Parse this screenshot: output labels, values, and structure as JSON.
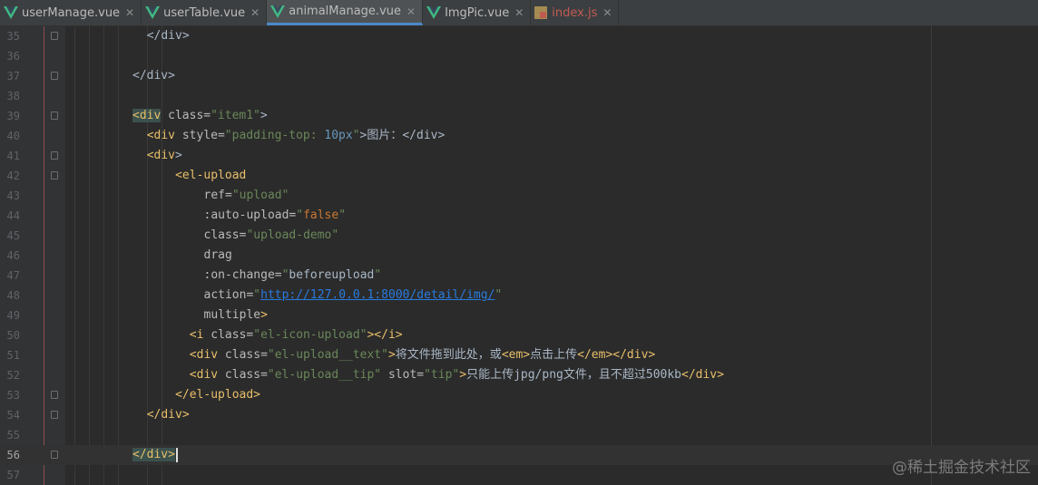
{
  "tabs": [
    {
      "label": "userManage.vue",
      "icon": "vue-icon",
      "active": false
    },
    {
      "label": "userTable.vue",
      "icon": "vue-icon",
      "active": false
    },
    {
      "label": "animalManage.vue",
      "icon": "vue-icon",
      "active": true
    },
    {
      "label": "ImgPic.vue",
      "icon": "vue-icon",
      "active": false
    },
    {
      "label": "index.js",
      "icon": "js-file-icon",
      "active": false
    }
  ],
  "close_glyph": "✕",
  "current_line": 56,
  "lines": [
    {
      "num": "35",
      "fold": true,
      "indent": 2,
      "tokens": [
        [
          "d",
          "</div>"
        ]
      ]
    },
    {
      "num": "36",
      "fold": false,
      "indent": 0,
      "tokens": []
    },
    {
      "num": "37",
      "fold": true,
      "indent": 0,
      "tokens": [
        [
          "d",
          "</div>"
        ]
      ]
    },
    {
      "num": "38",
      "fold": false,
      "indent": 0,
      "tokens": []
    },
    {
      "num": "39",
      "fold": true,
      "indent": 0,
      "tokens": [
        [
          "t",
          "<div"
        ],
        [
          "a",
          " class="
        ],
        [
          "s",
          "\"item1\""
        ],
        [
          "d",
          ">"
        ]
      ]
    },
    {
      "num": "40",
      "fold": false,
      "indent": 2,
      "tokens": [
        [
          "t",
          "<div"
        ],
        [
          "a",
          " style="
        ],
        [
          "s",
          "\"padding-top: "
        ],
        [
          "n",
          "10px"
        ],
        [
          "s",
          "\""
        ],
        [
          "d",
          ">图片：</div>"
        ]
      ]
    },
    {
      "num": "41",
      "fold": true,
      "indent": 2,
      "tokens": [
        [
          "t",
          "<div"
        ],
        [
          "d",
          ">"
        ]
      ]
    },
    {
      "num": "42",
      "fold": true,
      "indent": 6,
      "tokens": [
        [
          "t",
          "<el-upload"
        ]
      ]
    },
    {
      "num": "43",
      "fold": false,
      "indent": 10,
      "tokens": [
        [
          "a",
          "ref="
        ],
        [
          "s",
          "\"upload\""
        ]
      ]
    },
    {
      "num": "44",
      "fold": false,
      "indent": 10,
      "tokens": [
        [
          "a",
          ":auto-upload="
        ],
        [
          "s",
          "\""
        ],
        [
          "k",
          "false"
        ],
        [
          "s",
          "\""
        ]
      ]
    },
    {
      "num": "45",
      "fold": false,
      "indent": 10,
      "tokens": [
        [
          "a",
          "class="
        ],
        [
          "s",
          "\"upload-demo\""
        ]
      ]
    },
    {
      "num": "46",
      "fold": false,
      "indent": 10,
      "tokens": [
        [
          "a",
          "drag"
        ]
      ]
    },
    {
      "num": "47",
      "fold": false,
      "indent": 10,
      "tokens": [
        [
          "a",
          ":on-change="
        ],
        [
          "s",
          "\""
        ],
        [
          "d",
          "beforeupload"
        ],
        [
          "s",
          "\""
        ]
      ]
    },
    {
      "num": "48",
      "fold": false,
      "indent": 10,
      "tokens": [
        [
          "a",
          "action="
        ],
        [
          "s",
          "\""
        ],
        [
          "u",
          "http://127.0.0.1:8000/detail/img/"
        ],
        [
          "s",
          "\""
        ]
      ]
    },
    {
      "num": "49",
      "fold": false,
      "indent": 10,
      "tokens": [
        [
          "a",
          "multiple"
        ],
        [
          "t",
          ">"
        ]
      ]
    },
    {
      "num": "50",
      "fold": false,
      "indent": 8,
      "tokens": [
        [
          "t",
          "<i"
        ],
        [
          "a",
          " class="
        ],
        [
          "s",
          "\"el-icon-upload\""
        ],
        [
          "t",
          "></i>"
        ]
      ]
    },
    {
      "num": "51",
      "fold": false,
      "indent": 8,
      "tokens": [
        [
          "t",
          "<div"
        ],
        [
          "a",
          " class="
        ],
        [
          "s",
          "\"el-upload__text\""
        ],
        [
          "t",
          ">"
        ],
        [
          "d",
          "将文件拖到此处，或"
        ],
        [
          "t",
          "<em>"
        ],
        [
          "d",
          "点击上传"
        ],
        [
          "t",
          "</em></div>"
        ]
      ]
    },
    {
      "num": "52",
      "fold": false,
      "indent": 8,
      "tokens": [
        [
          "t",
          "<div"
        ],
        [
          "a",
          " class="
        ],
        [
          "s",
          "\"el-upload__tip\""
        ],
        [
          "a",
          " slot="
        ],
        [
          "s",
          "\"tip\""
        ],
        [
          "t",
          ">"
        ],
        [
          "d",
          "只能上传jpg/png文件，且不超过500kb"
        ],
        [
          "t",
          "</div>"
        ]
      ]
    },
    {
      "num": "53",
      "fold": true,
      "indent": 6,
      "tokens": [
        [
          "t",
          "</el-upload>"
        ]
      ]
    },
    {
      "num": "54",
      "fold": true,
      "indent": 2,
      "tokens": [
        [
          "t",
          "</div>"
        ]
      ]
    },
    {
      "num": "55",
      "fold": false,
      "indent": 0,
      "tokens": []
    },
    {
      "num": "56",
      "fold": true,
      "indent": 0,
      "tokens": [
        [
          "t",
          "</div>"
        ]
      ]
    },
    {
      "num": "57",
      "fold": false,
      "indent": 0,
      "tokens": []
    }
  ],
  "watermark": "@稀土掘金技术社区"
}
